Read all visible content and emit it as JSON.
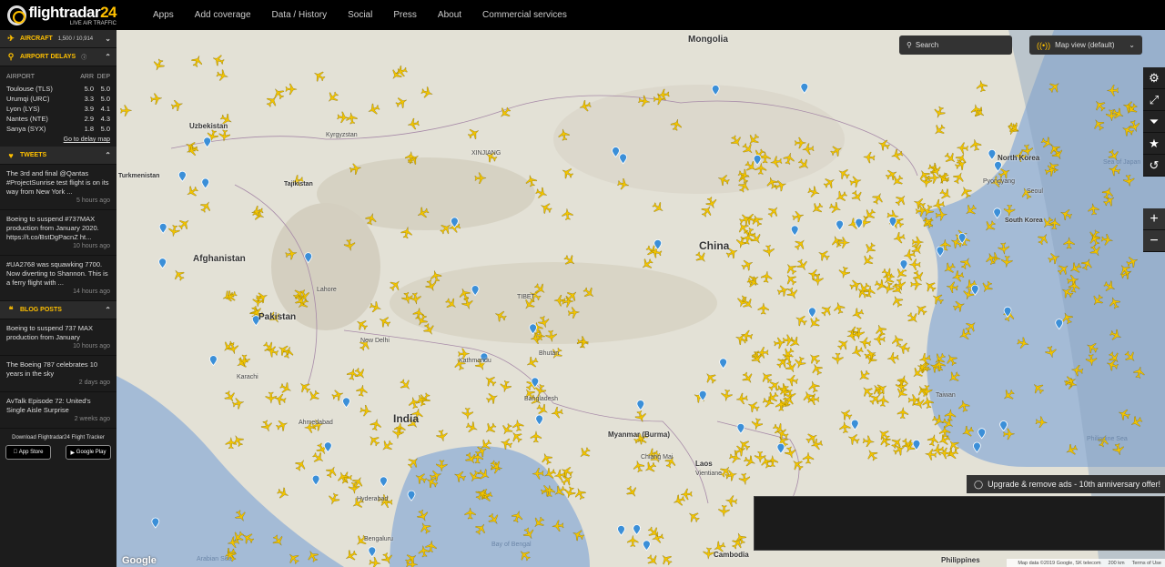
{
  "app": {
    "logo_name_a": "flightradar",
    "logo_name_b": "24",
    "logo_sub": "LIVE AIR TRAFFIC"
  },
  "nav": [
    "Apps",
    "Add coverage",
    "Data / History",
    "Social",
    "Press",
    "About",
    "Commercial services"
  ],
  "sidebar": {
    "aircraft": {
      "label": "AIRCRAFT",
      "count": "1,500 / 10,914",
      "icon": "plane-icon"
    },
    "delays": {
      "label": "AIRPORT DELAYS",
      "col_airport": "AIRPORT",
      "col_arr": "ARR",
      "col_dep": "DEP",
      "rows": [
        {
          "airport": "Toulouse (TLS)",
          "arr": "5.0",
          "dep": "5.0"
        },
        {
          "airport": "Urumqi (URC)",
          "arr": "3.3",
          "dep": "5.0"
        },
        {
          "airport": "Lyon (LYS)",
          "arr": "3.9",
          "dep": "4.1"
        },
        {
          "airport": "Nantes (NTE)",
          "arr": "2.9",
          "dep": "4.3"
        },
        {
          "airport": "Sanya (SYX)",
          "arr": "1.8",
          "dep": "5.0"
        }
      ],
      "link": "Go to delay map"
    },
    "tweets": {
      "label": "TWEETS",
      "items": [
        {
          "text": "The 3rd and final @Qantas #ProjectSunrise test flight is on its way from New York ...",
          "ago": "5 hours ago"
        },
        {
          "text": "Boeing to suspend #737MAX production from January 2020. https://t.co/BstDgPacnZ ht...",
          "ago": "10 hours ago"
        },
        {
          "text": "#UA2768 was squawking 7700. Now diverting to Shannon. This is a ferry flight with ...",
          "ago": "14 hours ago"
        }
      ]
    },
    "blog": {
      "label": "BLOG POSTS",
      "items": [
        {
          "text": "Boeing to suspend 737 MAX production from January",
          "ago": "10 hours ago"
        },
        {
          "text": "The Boeing 787 celebrates 10 years in the sky",
          "ago": "2 days ago"
        },
        {
          "text": "AvTalk Episode 72: United's Single Aisle Surprise",
          "ago": "2 weeks ago"
        }
      ]
    },
    "download": {
      "label": "Download Flightradar24 Flight Tracker",
      "appstore": "App Store",
      "googleplay": "Google Play"
    }
  },
  "map": {
    "search_placeholder": "Search",
    "view": "Map view (default)",
    "upgrade": "Upgrade & remove ads - 10th anniversary offer!",
    "attribution": "Map data ©2019 Google, SK telecom",
    "scale": "200 km",
    "terms": "Terms of Use",
    "google": "Google",
    "labels": {
      "mongolia": "Mongolia",
      "china": "China",
      "afghanistan": "Afghanistan",
      "pakistan": "Pakistan",
      "india": "India",
      "myanmar": "Myanmar\n(Burma)",
      "laos": "Laos",
      "cambodia": "Cambodia",
      "north_korea": "North Korea",
      "south_korea": "South Korea",
      "uzbekistan": "Uzbekistan",
      "tajikistan": "Tajikistan",
      "kyrgyzstan": "Kyrgyzstan",
      "turkmenistan": "Turkmenistan",
      "xinjiang": "XINJIANG",
      "tibet": "TIBET",
      "kathmandu": "Kathmandu",
      "bhutan": "Bhutan",
      "bangladesh": "Bangladesh",
      "taiwan": "Taiwan",
      "philippines": "Philippines",
      "sea_of_japan": "Sea of Japan",
      "philippine_sea": "Philippine Sea",
      "arabian_sea": "Arabian Sea",
      "bay_of_bengal": "Bay of Bengal",
      "new_delhi": "New Delhi",
      "lahore": "Lahore",
      "karachi": "Karachi",
      "ahmedabad": "Ahmedabad",
      "hyderabad": "Hyderabad",
      "bengaluru": "Bengaluru",
      "chiang_mai": "Chiang Mai",
      "vientiane": "Vientiane",
      "pyongyang": "Pyongyang",
      "seoul": "Seoul"
    }
  },
  "colors": {
    "accent": "#ffc000",
    "plane": "#f2c400",
    "land": "#e4e2d8",
    "sea": "#9fb7d4"
  }
}
